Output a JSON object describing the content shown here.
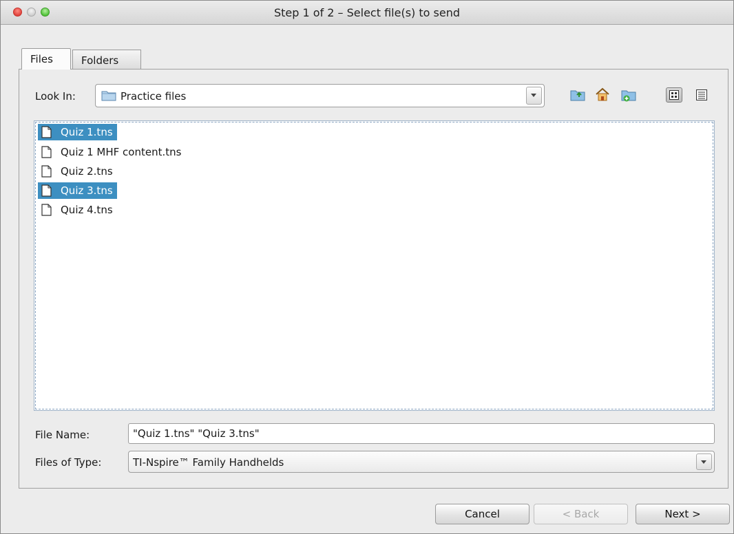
{
  "window": {
    "title": "Step 1 of 2 – Select file(s) to send"
  },
  "tabs": [
    {
      "label": "Files",
      "active": true
    },
    {
      "label": "Folders",
      "active": false
    }
  ],
  "look_in": {
    "label": "Look In:",
    "value": "Practice files",
    "icon": "folder-icon"
  },
  "toolbar": {
    "icons": [
      "up-folder-icon",
      "home-icon",
      "new-folder-icon",
      "list-view-icon",
      "details-view-icon"
    ],
    "active_view": "list-view-icon"
  },
  "files": [
    {
      "name": "Quiz 1.tns",
      "selected": true
    },
    {
      "name": "Quiz 1 MHF content.tns",
      "selected": false
    },
    {
      "name": "Quiz 2.tns",
      "selected": false
    },
    {
      "name": "Quiz 3.tns",
      "selected": true
    },
    {
      "name": "Quiz 4.tns",
      "selected": false
    }
  ],
  "file_name": {
    "label": "File Name:",
    "value": "\"Quiz 1.tns\" \"Quiz 3.tns\""
  },
  "file_type": {
    "label": "Files of Type:",
    "value": "TI-Nspire™ Family Handhelds"
  },
  "buttons": {
    "cancel": "Cancel",
    "back": "< Back",
    "next": "Next >"
  },
  "colors": {
    "selection": "#3d8fc1",
    "window_bg": "#ececec"
  }
}
